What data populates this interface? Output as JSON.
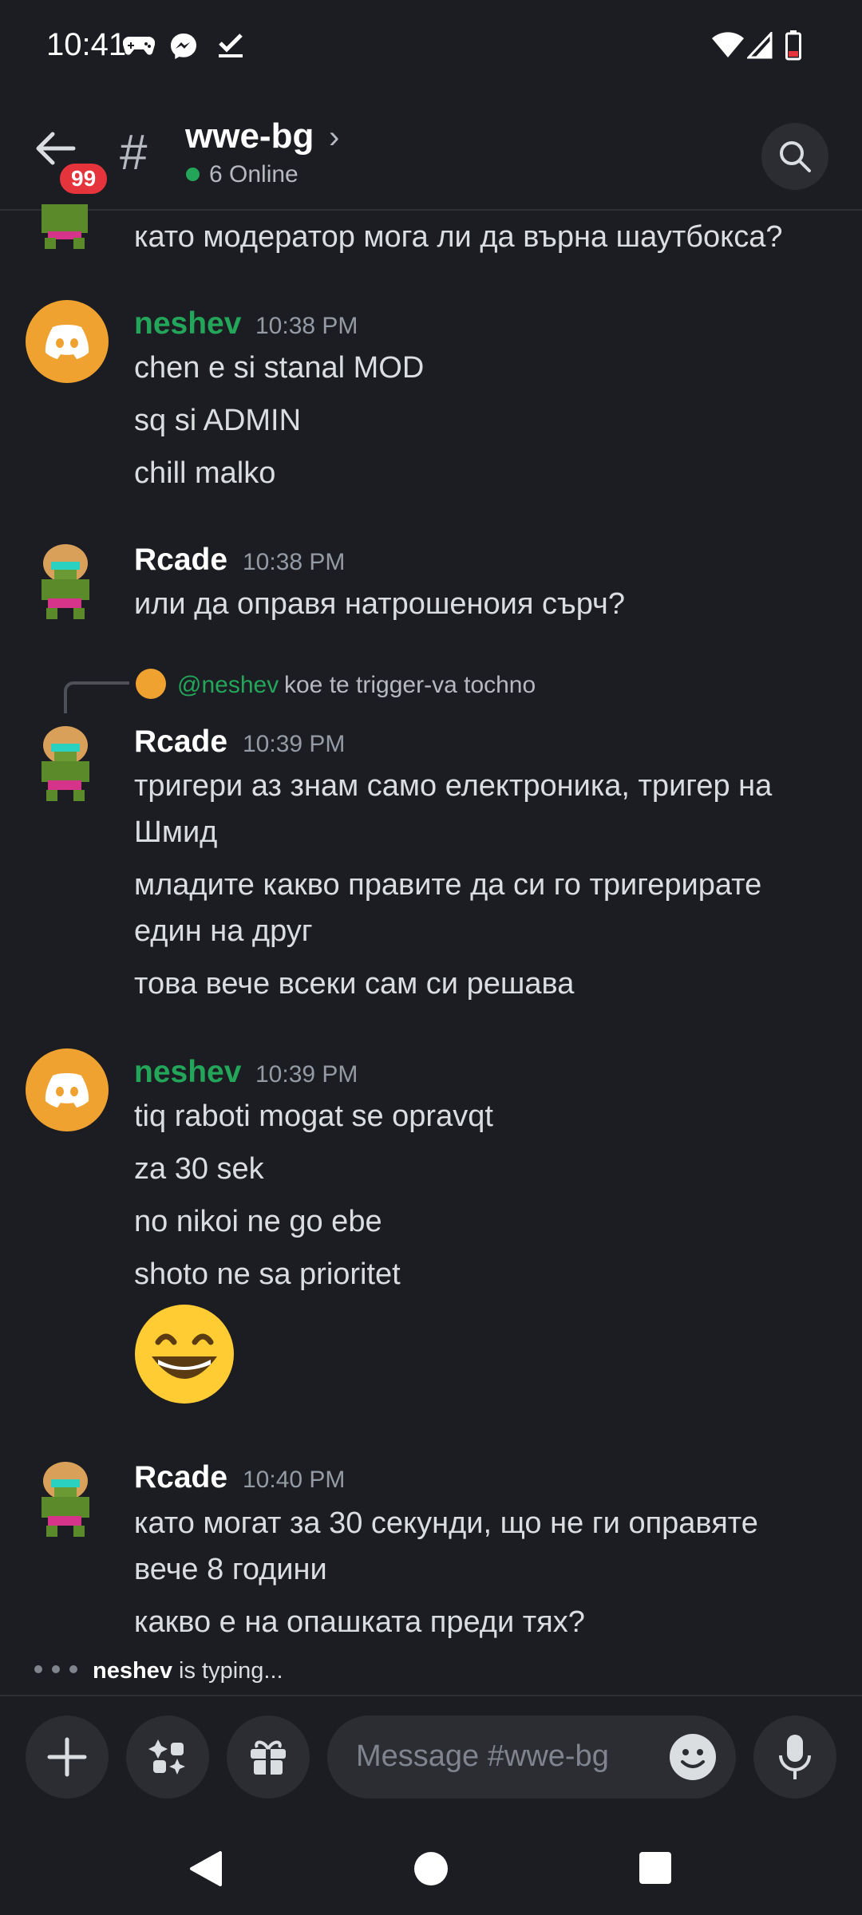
{
  "status_bar": {
    "time": "10:41"
  },
  "header": {
    "badge": "99",
    "hash": "#",
    "channel": "wwe-bg",
    "online": "6 Online",
    "chevron": "›"
  },
  "messages": {
    "top_line": "като модератор мога ли да върна шаутбокса?",
    "m1": {
      "author": "neshev",
      "time": "10:38 PM",
      "lines": [
        "chen e si stanal MOD",
        "sq si ADMIN",
        "chill malko"
      ]
    },
    "m2": {
      "author": "Rcade",
      "time": "10:38 PM",
      "lines": [
        "или да оправя натрошенoия сърч?"
      ]
    },
    "reply": {
      "mention": "@neshev",
      "text": "koe te trigger-va tochno"
    },
    "m3": {
      "author": "Rcade",
      "time": "10:39 PM",
      "lines": [
        "тригери аз знам само електроника, тригер на",
        "Шмид",
        "младите какво правите да си го тригерирате",
        "един на друг",
        "това вече всеки сам си решава"
      ]
    },
    "m4": {
      "author": "neshev",
      "time": "10:39 PM",
      "lines": [
        "tiq raboti mogat se opravqt",
        "za 30 sek",
        "no nikoi ne go ebe",
        "shoto ne sa prioritet"
      ],
      "emoji": "grinning-face-with-smiling-eyes"
    },
    "m5": {
      "author": "Rcade",
      "time": "10:40 PM",
      "lines": [
        "като могат за 30 секунди, що не ги оправяте",
        "вече 8 години",
        "какво е на опашката преди тях?"
      ]
    }
  },
  "typing": {
    "user": "neshev",
    "text": " is typing..."
  },
  "composer": {
    "placeholder": "Message #wwe-bg"
  },
  "colors": {
    "bg": "#1c1d22",
    "green_name": "#23a55a",
    "white_name": "#ffffff",
    "badge": "#e5343c",
    "discord_avatar": "#f0a230"
  }
}
